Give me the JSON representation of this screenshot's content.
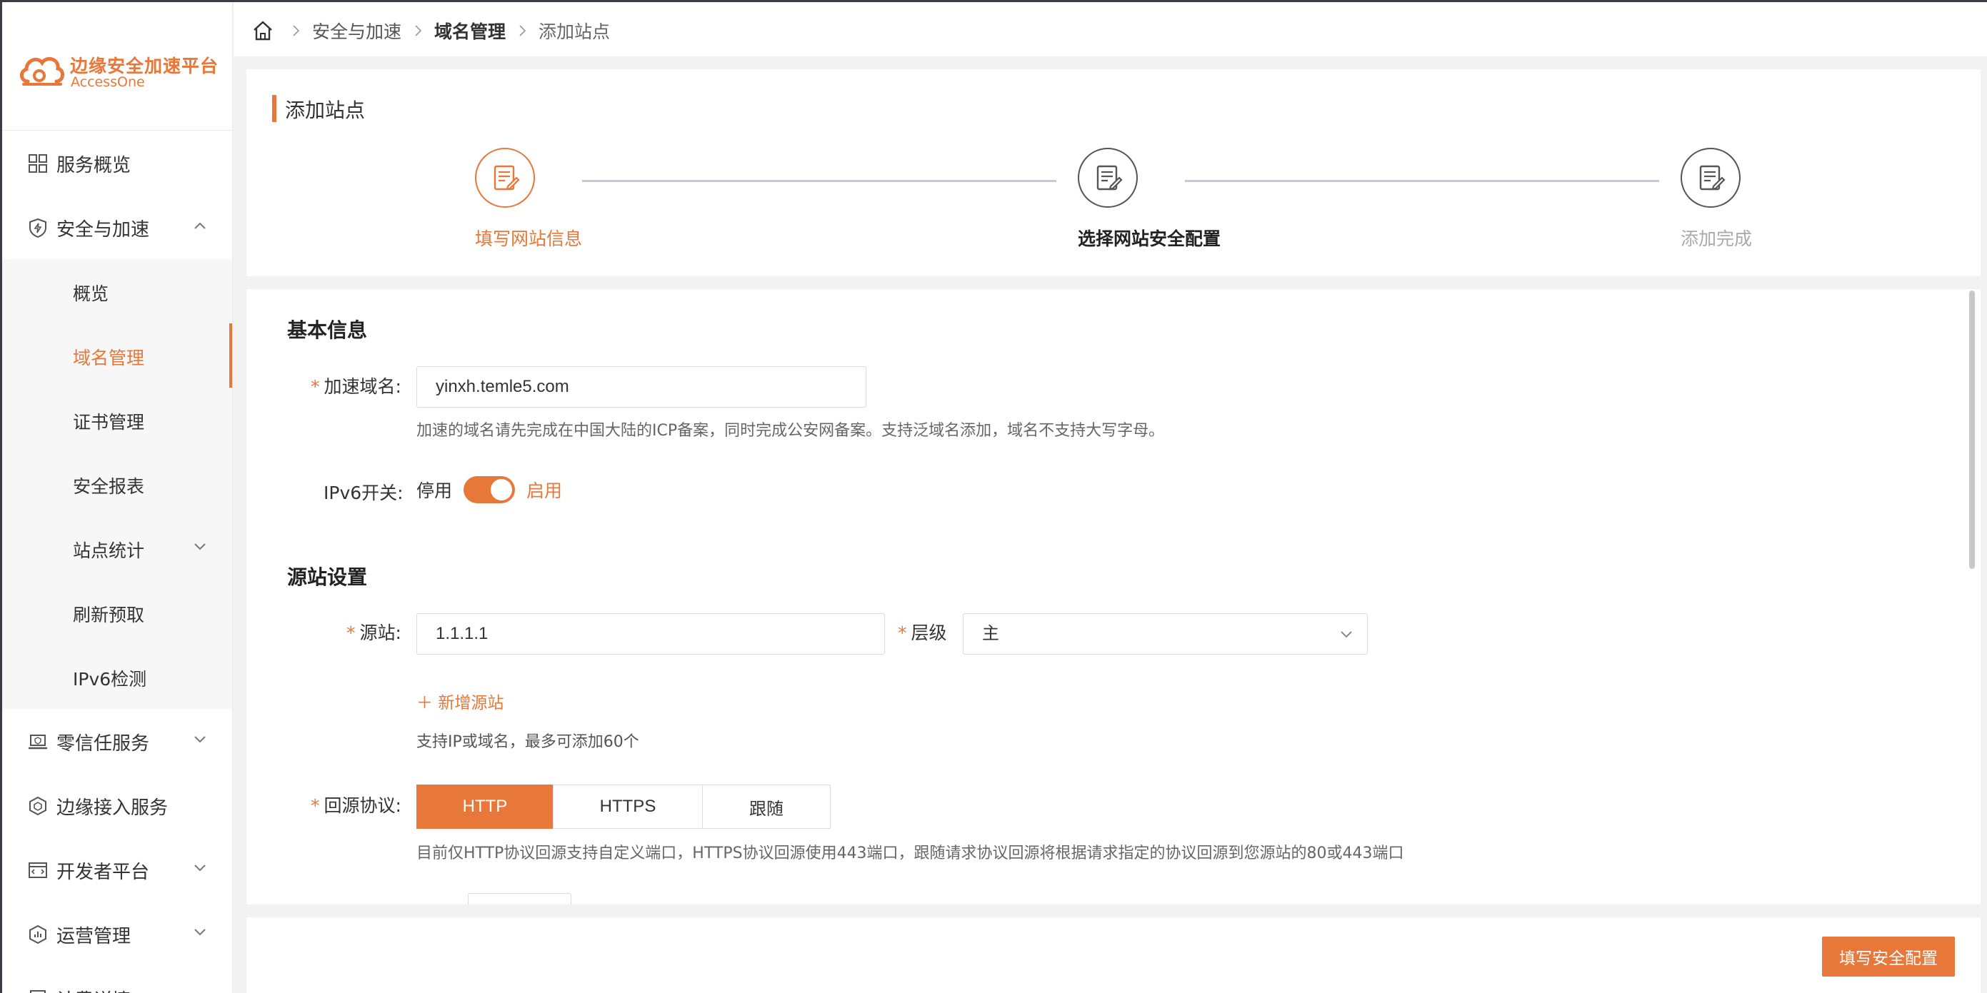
{
  "brand": {
    "title": "边缘安全加速平台",
    "subtitle": "AccessOne",
    "accent_color": "#e8773a"
  },
  "breadcrumb": [
    "安全与加速",
    "域名管理",
    "添加站点"
  ],
  "sidebar": {
    "items": [
      {
        "label": "服务概览",
        "icon": "grid-icon"
      },
      {
        "label": "安全与加速",
        "icon": "shield-icon",
        "expanded": true
      },
      {
        "label": "零信任服务",
        "icon": "laptop-shield-icon"
      },
      {
        "label": "边缘接入服务",
        "icon": "hexagon-icon"
      },
      {
        "label": "开发者平台",
        "icon": "code-window-icon"
      },
      {
        "label": "运营管理",
        "icon": "hex-chart-icon"
      },
      {
        "label": "计费详情",
        "icon": "bill-icon"
      }
    ],
    "sub_items": [
      {
        "label": "概览"
      },
      {
        "label": "域名管理",
        "active": true
      },
      {
        "label": "证书管理"
      },
      {
        "label": "安全报表"
      },
      {
        "label": "站点统计"
      },
      {
        "label": "刷新预取"
      },
      {
        "label": "IPv6检测"
      }
    ]
  },
  "steps": {
    "title": "添加站点",
    "items": [
      {
        "label": "填写网站信息",
        "state": "done"
      },
      {
        "label": "选择网站安全配置",
        "state": "current"
      },
      {
        "label": "添加完成",
        "state": "pending"
      }
    ]
  },
  "form": {
    "basic_title": "基本信息",
    "domain_label": "加速域名:",
    "domain_value": "yinxh.temle5.com",
    "domain_hint": "加速的域名请先完成在中国大陆的ICP备案，同时完成公安网备案。支持泛域名添加，域名不支持大写字母。",
    "ipv6_label": "IPv6开关:",
    "ipv6_off": "停用",
    "ipv6_on": "启用",
    "origin_title": "源站设置",
    "origin_label": "源站:",
    "origin_value": "1.1.1.1",
    "level_label": "层级",
    "level_value": "主",
    "add_origin": "新增源站",
    "origin_hint": "支持IP或域名，最多可添加60个",
    "protocol_label": "回源协议:",
    "protocol_options": [
      "HTTP",
      "HTTPS",
      "跟随"
    ],
    "protocol_selected": "HTTP",
    "protocol_hint": "目前仅HTTP协议回源支持自定义端口，HTTPS协议回源使用443端口，跟随请求协议回源将根据请求指定的协议回源到您源站的80或443端口"
  },
  "footer": {
    "next_label": "填写安全配置"
  }
}
